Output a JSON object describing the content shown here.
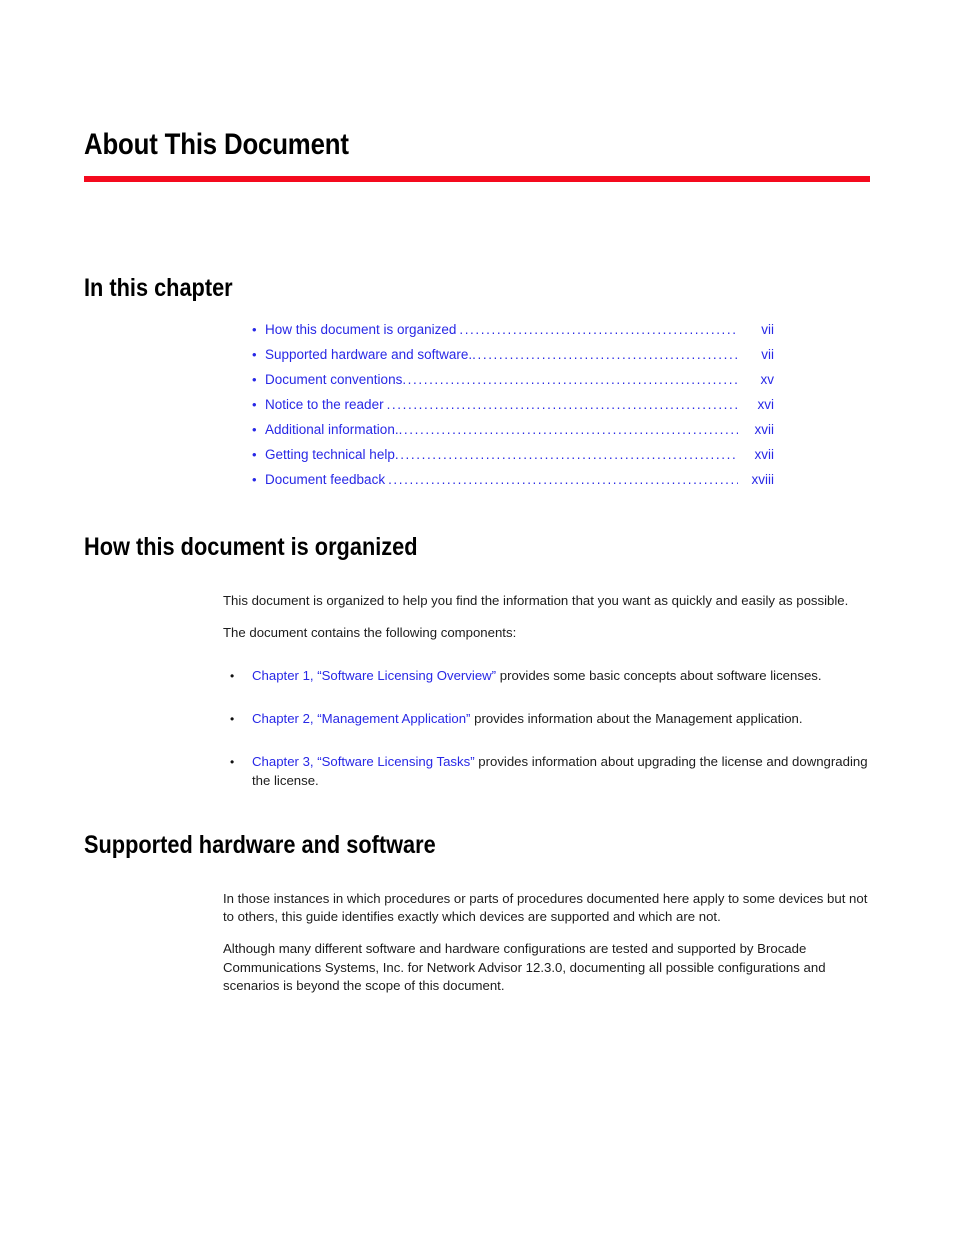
{
  "document": {
    "title": "About This Document",
    "rule_color": "#f40a1e",
    "link_color": "#2828e6",
    "text_color": "#1c1c1c"
  },
  "sections": {
    "in_this_chapter": {
      "heading": "In this chapter",
      "toc": [
        {
          "bullet": "•",
          "label": "How this document is organized",
          "page": "vii"
        },
        {
          "bullet": "•",
          "label": "Supported hardware and software.",
          "page": "vii"
        },
        {
          "bullet": "•",
          "label": "Document conventions",
          "page": "xv"
        },
        {
          "bullet": "•",
          "label": "Notice to the reader",
          "page": "xvi"
        },
        {
          "bullet": "•",
          "label": "Additional information.",
          "page": "xvii"
        },
        {
          "bullet": "•",
          "label": "Getting technical help",
          "page": "xvii"
        },
        {
          "bullet": "•",
          "label": "Document feedback",
          "page": "xviii"
        }
      ]
    },
    "how_organized": {
      "heading": "How this document is organized",
      "paragraphs": [
        "This document is organized to help you find the information that you want as quickly and easily as possible.",
        "The document contains the following components:"
      ],
      "items": [
        {
          "bullet": "•",
          "link": "Chapter 1, “Software Licensing Overview”",
          "text": " provides some basic concepts about software licenses."
        },
        {
          "bullet": "•",
          "link": "Chapter 2, “Management Application”",
          "text": " provides information about the Management application."
        },
        {
          "bullet": "•",
          "link": "Chapter 3, “Software Licensing Tasks”",
          "text": " provides information about upgrading the license and downgrading the license."
        }
      ]
    },
    "supported_hardware": {
      "heading": "Supported hardware and software",
      "paragraphs": [
        "In those instances in which procedures or parts of procedures documented here apply to some devices but not to others, this guide identifies exactly which devices are supported and which are not.",
        "Although many different software and hardware configurations are tested and supported by Brocade Communications Systems, Inc. for Network Advisor 12.3.0, documenting all possible configurations and scenarios is beyond the scope of this document."
      ]
    }
  }
}
